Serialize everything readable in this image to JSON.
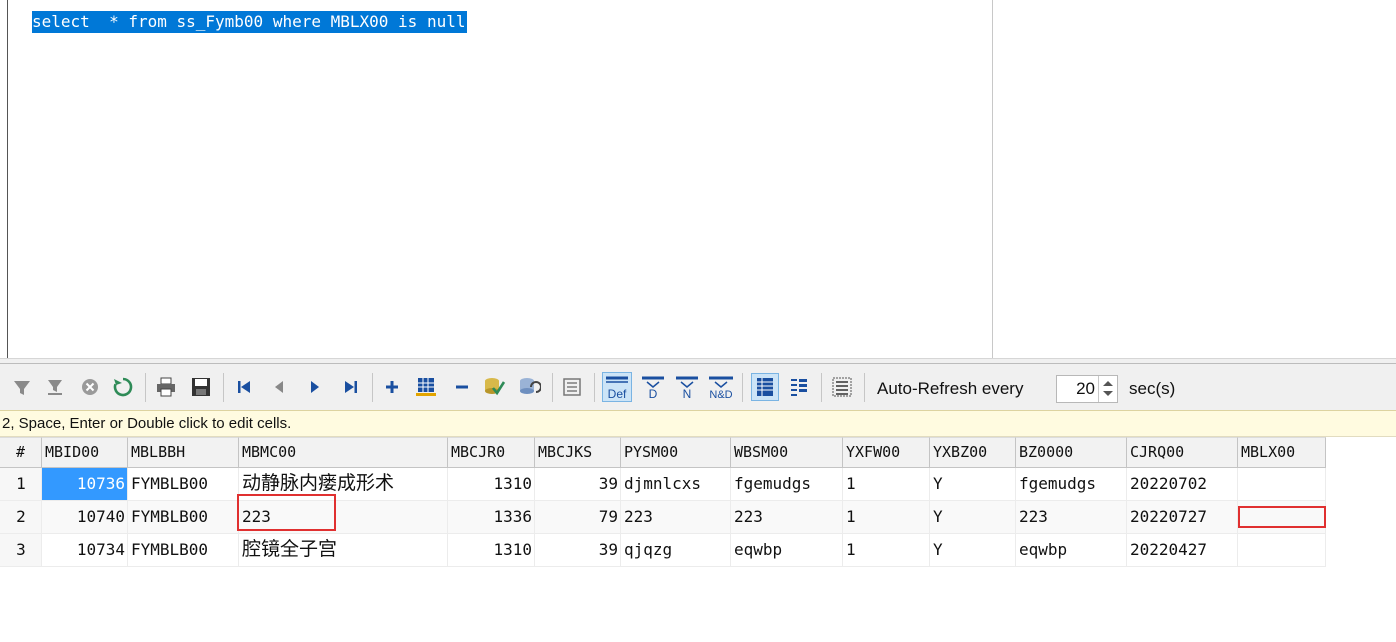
{
  "editor": {
    "sql": "select  * from ss_Fymb00 where MBLX00 is null"
  },
  "toolbar": {
    "icons": [
      "filter-icon",
      "filter-clear-icon",
      "cancel-icon",
      "refresh-icon",
      "print-icon",
      "save-icon",
      "first-record-icon",
      "prev-record-icon",
      "next-record-icon",
      "last-record-icon",
      "add-row-icon",
      "duplicate-row-icon",
      "delete-row-icon",
      "post-icon",
      "cancel-edit-icon",
      "grid-icon",
      "default-icon",
      "d-icon",
      "n-icon",
      "nd-icon",
      "grid-view-icon",
      "form-view-icon",
      "text-view-icon"
    ],
    "labels": {
      "def": "Def",
      "d": "D",
      "n": "N",
      "nd": "N&D"
    },
    "auto_refresh_label": "Auto-Refresh every",
    "refresh_value": "20",
    "sec_label": "sec(s)"
  },
  "hint": "2, Space, Enter or Double click to edit cells.",
  "table": {
    "columns": [
      "#",
      "MBID00",
      "MBLBBH",
      "MBMC00",
      "MBCJR0",
      "MBCJKS",
      "PYSM00",
      "WBSM00",
      "YXFW00",
      "YXBZ00",
      "BZ0000",
      "CJRQ00",
      "MBLX00"
    ],
    "rows": [
      [
        "1",
        "10736",
        "FYMBLB00",
        "动静脉内瘘成形术",
        "1310",
        "39",
        "djmnlcxs",
        "fgemudgs",
        "1",
        "Y",
        "fgemudgs",
        "20220702",
        ""
      ],
      [
        "2",
        "10740",
        "FYMBLB00",
        "223",
        "1336",
        "79",
        "223",
        "223",
        "1",
        "Y",
        "223",
        "20220727",
        ""
      ],
      [
        "3",
        "10734",
        "FYMBLB00",
        "腔镜全子宫",
        "1310",
        "39",
        "qjqzg",
        "eqwbp",
        "1",
        "Y",
        "eqwbp",
        "20220427",
        ""
      ]
    ]
  },
  "colors": {
    "selection": "#0078d7",
    "cell_selected": "#3399ff",
    "highlight_box": "#e03030",
    "hint_bg": "#fffbe0"
  }
}
